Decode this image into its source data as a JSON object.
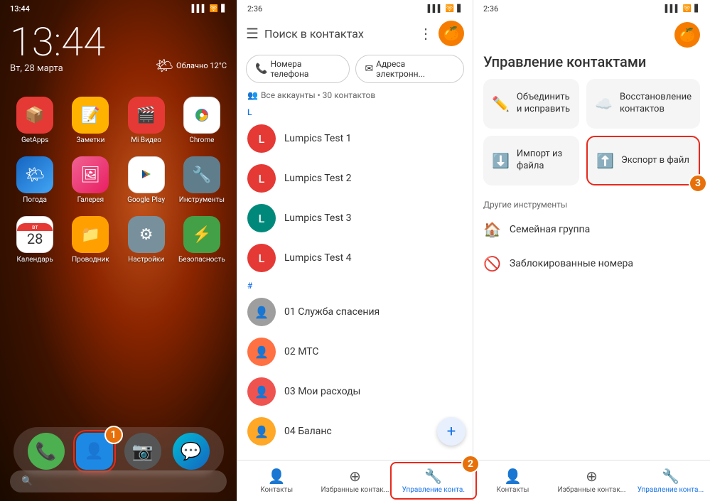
{
  "home": {
    "time": "13:44",
    "date": "Вт, 28 марта",
    "weather": "Облачно 12°C",
    "weather_icon": "🌤",
    "status_time": "13:44",
    "signal": "📶",
    "wifi": "🛜",
    "battery": "🔋",
    "apps_row1": [
      {
        "label": "GetApps",
        "bg": "#e53935",
        "icon": "📦"
      },
      {
        "label": "Заметки",
        "bg": "#ffb300",
        "icon": "📝"
      },
      {
        "label": "Mi Видео",
        "bg": "#e53935",
        "icon": "🎬"
      },
      {
        "label": "Chrome",
        "bg": "#fff",
        "icon": "🌐"
      }
    ],
    "apps_row2": [
      {
        "label": "Погода",
        "bg": "#1565c0",
        "icon": "🌤"
      },
      {
        "label": "Галерея",
        "bg": "#f06292",
        "icon": "🖼"
      },
      {
        "label": "Google Play",
        "bg": "#fff",
        "icon": "▶"
      },
      {
        "label": "Инструменты",
        "bg": "#607d8b",
        "icon": "🔧"
      }
    ],
    "calendar_date": "28",
    "dock_row": [
      {
        "label": "Календарь",
        "bg": "#fff",
        "icon": "📅"
      },
      {
        "label": "Проводник",
        "bg": "#ffa000",
        "icon": "📁"
      },
      {
        "label": "Настройки",
        "bg": "#78909c",
        "icon": "⚙"
      },
      {
        "label": "Безопасность",
        "bg": "#43a047",
        "icon": "⚡"
      }
    ],
    "bottom_dock": [
      {
        "label": "phone",
        "icon": "📞",
        "bg": "#4caf50"
      },
      {
        "label": "contacts",
        "icon": "👤",
        "bg": "#1e88e5",
        "highlighted": true
      },
      {
        "label": "camera",
        "icon": "📷",
        "bg": "#555"
      },
      {
        "label": "messages",
        "icon": "💬",
        "bg": "#00bcd4"
      }
    ],
    "search_placeholder": "🔍",
    "step1_badge": "1"
  },
  "contacts": {
    "status_time": "2:36",
    "search_placeholder": "Поиск в контактах",
    "filter_phone": "Номера телефона",
    "filter_email": "Адреса электронн...",
    "all_accounts": "Все аккаунты • 30 контактов",
    "section_l": "L",
    "section_hash": "#",
    "contacts_list": [
      {
        "name": "Lumpics Test 1",
        "letter": "L",
        "color": "#e53935"
      },
      {
        "name": "Lumpics Test 2",
        "letter": "L",
        "color": "#e53935"
      },
      {
        "name": "Lumpics Test 3",
        "letter": "L",
        "color": "#00897b"
      },
      {
        "name": "Lumpics Test 4",
        "letter": "L",
        "color": "#e53935"
      },
      {
        "name": "01 Служба спасения",
        "letter": "👤",
        "color": "#9e9e9e"
      },
      {
        "name": "02 МТС",
        "letter": "👤",
        "color": "#ff7043"
      },
      {
        "name": "03 Мои расходы",
        "letter": "👤",
        "color": "#ef5350"
      },
      {
        "name": "04 Баланс",
        "letter": "👤",
        "color": "#ffa726"
      }
    ],
    "fab_icon": "+",
    "nav_items": [
      {
        "label": "Контакты",
        "icon": "👤",
        "active": false
      },
      {
        "label": "Избранные контак...",
        "icon": "⊕",
        "active": false
      },
      {
        "label": "Управление конта.",
        "icon": "🔧",
        "active": true
      }
    ],
    "step2_badge": "2"
  },
  "manage": {
    "status_time": "2:36",
    "title": "Управление контактами",
    "cards": [
      {
        "icon": "✏",
        "text": "Объединить и исправить"
      },
      {
        "icon": "☁",
        "text": "Восстановление контактов"
      },
      {
        "icon": "⬇",
        "text": "Импорт из файла"
      },
      {
        "icon": "⬆",
        "text": "Экспорт в файл",
        "highlighted": true
      }
    ],
    "other_tools_title": "Другие инструменты",
    "list_items": [
      {
        "icon": "🏠",
        "label": "Семейная группа"
      },
      {
        "icon": "🚫",
        "label": "Заблокированные номера"
      }
    ],
    "nav_items": [
      {
        "label": "Контакты",
        "icon": "👤",
        "active": false
      },
      {
        "label": "Избранные контак...",
        "icon": "⊕",
        "active": false
      },
      {
        "label": "Управление конта...",
        "icon": "🔧",
        "active": true
      }
    ],
    "step3_badge": "3",
    "avatar_icon": "🍊"
  }
}
